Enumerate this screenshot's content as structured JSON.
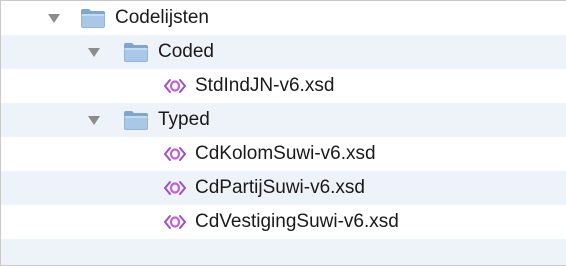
{
  "tree": {
    "items": [
      {
        "label": "Codelijsten",
        "type": "folder",
        "expanded": true,
        "icon": "folder-icon",
        "disclosure_icon": "disclosure-triangle-down-icon"
      },
      {
        "label": "Coded",
        "type": "folder",
        "expanded": true,
        "icon": "folder-icon",
        "disclosure_icon": "disclosure-triangle-down-icon"
      },
      {
        "label": "StdIndJN-v6.xsd",
        "type": "file",
        "icon": "xsd-file-icon"
      },
      {
        "label": "Typed",
        "type": "folder",
        "expanded": true,
        "icon": "folder-icon",
        "disclosure_icon": "disclosure-triangle-down-icon"
      },
      {
        "label": "CdKolomSuwi-v6.xsd",
        "type": "file",
        "icon": "xsd-file-icon"
      },
      {
        "label": "CdPartijSuwi-v6.xsd",
        "type": "file",
        "icon": "xsd-file-icon"
      },
      {
        "label": "CdVestigingSuwi-v6.xsd",
        "type": "file",
        "icon": "xsd-file-icon"
      }
    ]
  },
  "colors": {
    "alternate_row": "#eef2f9",
    "folder_blue": "#8fb3d6",
    "xsd_icon_purple": "#a64dc8"
  }
}
